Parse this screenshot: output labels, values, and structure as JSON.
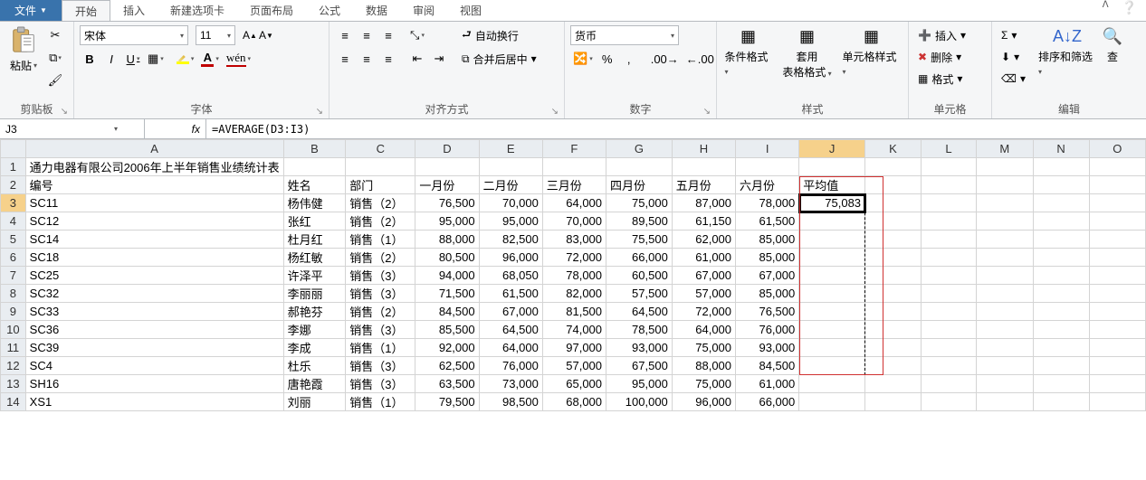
{
  "tabs": {
    "file": "文件",
    "items": [
      "开始",
      "插入",
      "新建选项卡",
      "页面布局",
      "公式",
      "数据",
      "审阅",
      "视图"
    ],
    "active": 0
  },
  "ribbon": {
    "clipboard": {
      "label": "剪贴板",
      "paste": "粘贴"
    },
    "font": {
      "label": "字体",
      "name": "宋体",
      "size": "11",
      "bold": "B",
      "italic": "I",
      "under": "U",
      "wen": "wén",
      "colorA": "A"
    },
    "align": {
      "label": "对齐方式",
      "wrap": "自动换行",
      "merge": "合并后居中"
    },
    "number": {
      "label": "数字",
      "format": "货币"
    },
    "styles": {
      "label": "样式",
      "cond": "条件格式",
      "table": "套用\n表格格式",
      "cell": "单元格样式"
    },
    "cells": {
      "label": "单元格",
      "insert": "插入",
      "delete": "删除",
      "format": "格式"
    },
    "editing": {
      "label": "编辑",
      "sortfilter": "排序和筛选",
      "find": "查"
    }
  },
  "namebox": "J3",
  "formula": "=AVERAGE(D3:I3)",
  "chart_data": {
    "type": "table",
    "note": "columns A..J == 编号,姓名,部门,一月份..六月份,平均值",
    "columns": [
      "A",
      "B",
      "C",
      "D",
      "E",
      "F",
      "G",
      "H",
      "I",
      "J",
      "K",
      "L",
      "M",
      "N",
      "O"
    ],
    "rows": [
      [
        "通力电器有限公司2006年上半年销售业绩统计表",
        "",
        "",
        "",
        "",
        "",
        "",
        "",
        "",
        "",
        "",
        "",
        "",
        "",
        ""
      ],
      [
        "编号",
        "姓名",
        "部门",
        "一月份",
        "二月份",
        "三月份",
        "四月份",
        "五月份",
        "六月份",
        "平均值",
        "",
        "",
        "",
        "",
        ""
      ],
      [
        "SC11",
        "杨伟健",
        "销售（2）",
        "76,500",
        "70,000",
        "64,000",
        "75,000",
        "87,000",
        "78,000",
        "75,083",
        "",
        "",
        "",
        "",
        ""
      ],
      [
        "SC12",
        "张红",
        "销售（2）",
        "95,000",
        "95,000",
        "70,000",
        "89,500",
        "61,150",
        "61,500",
        "",
        "",
        "",
        "",
        "",
        ""
      ],
      [
        "SC14",
        "杜月红",
        "销售（1）",
        "88,000",
        "82,500",
        "83,000",
        "75,500",
        "62,000",
        "85,000",
        "",
        "",
        "",
        "",
        "",
        ""
      ],
      [
        "SC18",
        "杨红敏",
        "销售（2）",
        "80,500",
        "96,000",
        "72,000",
        "66,000",
        "61,000",
        "85,000",
        "",
        "",
        "",
        "",
        "",
        ""
      ],
      [
        "SC25",
        "许泽平",
        "销售（3）",
        "94,000",
        "68,050",
        "78,000",
        "60,500",
        "67,000",
        "67,000",
        "",
        "",
        "",
        "",
        "",
        ""
      ],
      [
        "SC32",
        "李丽丽",
        "销售（3）",
        "71,500",
        "61,500",
        "82,000",
        "57,500",
        "57,000",
        "85,000",
        "",
        "",
        "",
        "",
        "",
        ""
      ],
      [
        "SC33",
        "郝艳芬",
        "销售（2）",
        "84,500",
        "67,000",
        "81,500",
        "64,500",
        "72,000",
        "76,500",
        "",
        "",
        "",
        "",
        "",
        ""
      ],
      [
        "SC36",
        "李娜",
        "销售（3）",
        "85,500",
        "64,500",
        "74,000",
        "78,500",
        "64,000",
        "76,000",
        "",
        "",
        "",
        "",
        "",
        ""
      ],
      [
        "SC39",
        "李成",
        "销售（1）",
        "92,000",
        "64,000",
        "97,000",
        "93,000",
        "75,000",
        "93,000",
        "",
        "",
        "",
        "",
        "",
        ""
      ],
      [
        "SC4",
        "杜乐",
        "销售（3）",
        "62,500",
        "76,000",
        "57,000",
        "67,500",
        "88,000",
        "84,500",
        "",
        "",
        "",
        "",
        "",
        ""
      ],
      [
        "SH16",
        "唐艳霞",
        "销售（3）",
        "63,500",
        "73,000",
        "65,000",
        "95,000",
        "75,000",
        "61,000",
        "",
        "",
        "",
        "",
        "",
        ""
      ],
      [
        "XS1",
        "刘丽",
        "销售（1）",
        "79,500",
        "98,500",
        "68,000",
        "100,000",
        "96,000",
        "66,000",
        "",
        "",
        "",
        "",
        "",
        ""
      ]
    ]
  },
  "selection": {
    "activeCell": "J3",
    "range": "J3:J12",
    "evalRange": "J2:J12"
  }
}
